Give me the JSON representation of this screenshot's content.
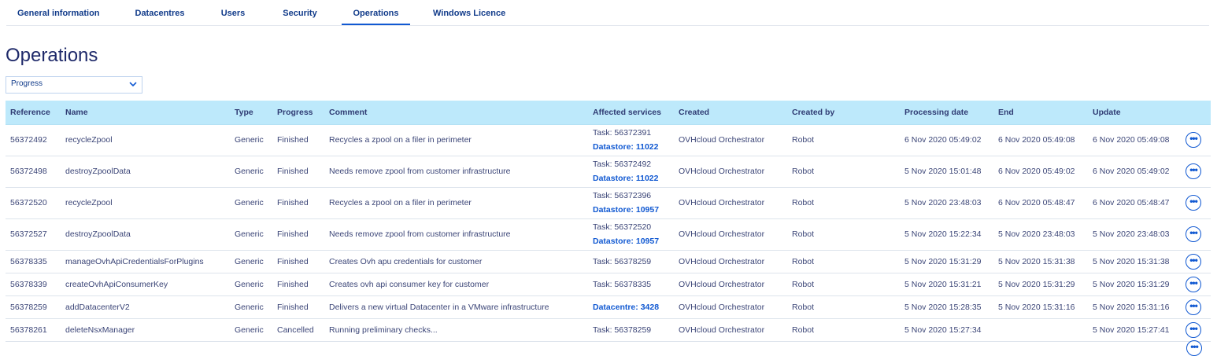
{
  "tabs": [
    {
      "label": "General information"
    },
    {
      "label": "Datacentres"
    },
    {
      "label": "Users"
    },
    {
      "label": "Security"
    },
    {
      "label": "Operations",
      "active": true
    },
    {
      "label": "Windows Licence"
    }
  ],
  "page_title": "Operations",
  "filter": {
    "selected": "Progress",
    "icon": "chevron-down-icon"
  },
  "table": {
    "headers": {
      "reference": "Reference",
      "name": "Name",
      "type": "Type",
      "progress": "Progress",
      "comment": "Comment",
      "affected": "Affected services",
      "created": "Created",
      "created_by": "Created by",
      "processing": "Processing date",
      "end": "End",
      "update": "Update"
    },
    "rows": [
      {
        "reference": "56372492",
        "name": "recycleZpool",
        "type": "Generic",
        "progress": "Finished",
        "comment": "Recycles a zpool on a filer in perimeter",
        "task": "Task: 56372391",
        "link": "Datastore: 11022",
        "created": "OVHcloud Orchestrator",
        "created_by": "Robot",
        "processing": "6 Nov 2020 05:49:02",
        "end": "6 Nov 2020 05:49:08",
        "update": "6 Nov 2020 05:49:08"
      },
      {
        "reference": "56372498",
        "name": "destroyZpoolData",
        "type": "Generic",
        "progress": "Finished",
        "comment": "Needs remove zpool from customer infrastructure",
        "task": "Task: 56372492",
        "link": "Datastore: 11022",
        "created": "OVHcloud Orchestrator",
        "created_by": "Robot",
        "processing": "5 Nov 2020 15:01:48",
        "end": "6 Nov 2020 05:49:02",
        "update": "6 Nov 2020 05:49:02"
      },
      {
        "reference": "56372520",
        "name": "recycleZpool",
        "type": "Generic",
        "progress": "Finished",
        "comment": "Recycles a zpool on a filer in perimeter",
        "task": "Task: 56372396",
        "link": "Datastore: 10957",
        "created": "OVHcloud Orchestrator",
        "created_by": "Robot",
        "processing": "5 Nov 2020 23:48:03",
        "end": "6 Nov 2020 05:48:47",
        "update": "6 Nov 2020 05:48:47"
      },
      {
        "reference": "56372527",
        "name": "destroyZpoolData",
        "type": "Generic",
        "progress": "Finished",
        "comment": "Needs remove zpool from customer infrastructure",
        "task": "Task: 56372520",
        "link": "Datastore: 10957",
        "created": "OVHcloud Orchestrator",
        "created_by": "Robot",
        "processing": "5 Nov 2020 15:22:34",
        "end": "5 Nov 2020 23:48:03",
        "update": "5 Nov 2020 23:48:03"
      },
      {
        "reference": "56378335",
        "name": "manageOvhApiCredentialsForPlugins",
        "type": "Generic",
        "progress": "Finished",
        "comment": "Creates Ovh apu credentials for customer",
        "task": "Task: 56378259",
        "link": null,
        "created": "OVHcloud Orchestrator",
        "created_by": "Robot",
        "processing": "5 Nov 2020 15:31:29",
        "end": "5 Nov 2020 15:31:38",
        "update": "5 Nov 2020 15:31:38"
      },
      {
        "reference": "56378339",
        "name": "createOvhApiConsumerKey",
        "type": "Generic",
        "progress": "Finished",
        "comment": "Creates ovh api consumer key for customer",
        "task": "Task: 56378335",
        "link": null,
        "created": "OVHcloud Orchestrator",
        "created_by": "Robot",
        "processing": "5 Nov 2020 15:31:21",
        "end": "5 Nov 2020 15:31:29",
        "update": "5 Nov 2020 15:31:29"
      },
      {
        "reference": "56378259",
        "name": "addDatacenterV2",
        "type": "Generic",
        "progress": "Finished",
        "comment": "Delivers a new virtual Datacenter in a VMware infrastructure",
        "task": null,
        "link": "Datacentre: 3428",
        "created": "OVHcloud Orchestrator",
        "created_by": "Robot",
        "processing": "5 Nov 2020 15:28:35",
        "end": "5 Nov 2020 15:31:16",
        "update": "5 Nov 2020 15:31:16"
      },
      {
        "reference": "56378261",
        "name": "deleteNsxManager",
        "type": "Generic",
        "progress": "Cancelled",
        "comment": "Running preliminary checks...",
        "task": "Task: 56378259",
        "link": null,
        "created": "OVHcloud Orchestrator",
        "created_by": "Robot",
        "processing": "5 Nov 2020 15:27:34",
        "end": "",
        "update": "5 Nov 2020 15:27:41"
      }
    ],
    "more_icon": "more-options-icon"
  }
}
